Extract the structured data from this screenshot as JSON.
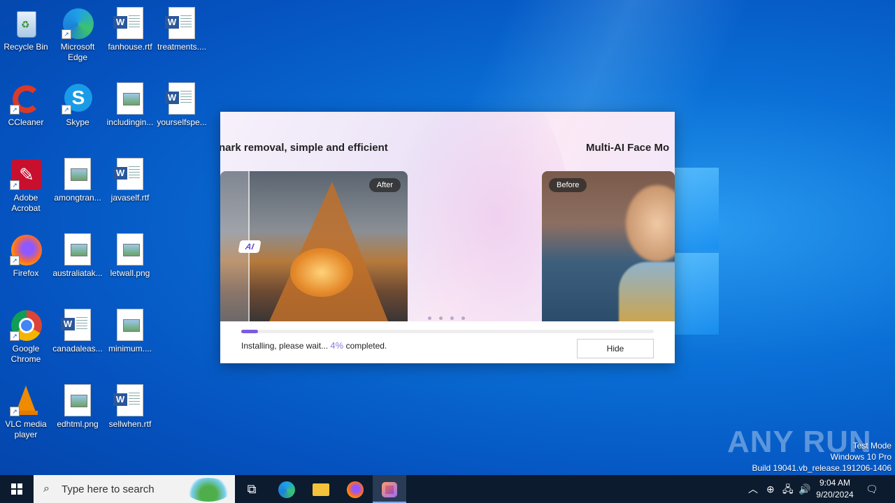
{
  "desktop": {
    "icons": [
      {
        "label": "Recycle Bin"
      },
      {
        "label": "Microsoft Edge"
      },
      {
        "label": "fanhouse.rtf"
      },
      {
        "label": "treatments...."
      },
      {
        "label": "CCleaner"
      },
      {
        "label": "Skype"
      },
      {
        "label": "includingin..."
      },
      {
        "label": "yourselfspe..."
      },
      {
        "label": "Adobe Acrobat"
      },
      {
        "label": "amongtran..."
      },
      {
        "label": "javaself.rtf"
      },
      {
        "label": "Firefox"
      },
      {
        "label": "australiatak..."
      },
      {
        "label": "letwall.png"
      },
      {
        "label": "Google Chrome"
      },
      {
        "label": "canadaleas..."
      },
      {
        "label": "minimum...."
      },
      {
        "label": "VLC media player"
      },
      {
        "label": "edhtml.png"
      },
      {
        "label": "sellwhen.rtf"
      }
    ]
  },
  "installer": {
    "slide_left_title": "nark removal, simple and efficient",
    "slide_right_title": "Multi-AI Face Mo",
    "after_tag": "After",
    "before_tag": "Before",
    "ai_badge": "AI",
    "progress_fraction": 0.04,
    "status_prefix": "Installing, please wait...",
    "status_percent": "4%",
    "status_suffix": "completed.",
    "hide_button": "Hide"
  },
  "watermark": {
    "text": "ANY RUN",
    "test_mode": "Test Mode",
    "edition": "Windows 10 Pro",
    "build": "Build 19041.vb_release.191206-1406"
  },
  "taskbar": {
    "search_placeholder": "Type here to search",
    "time": "9:04 AM",
    "date": "9/20/2024"
  }
}
